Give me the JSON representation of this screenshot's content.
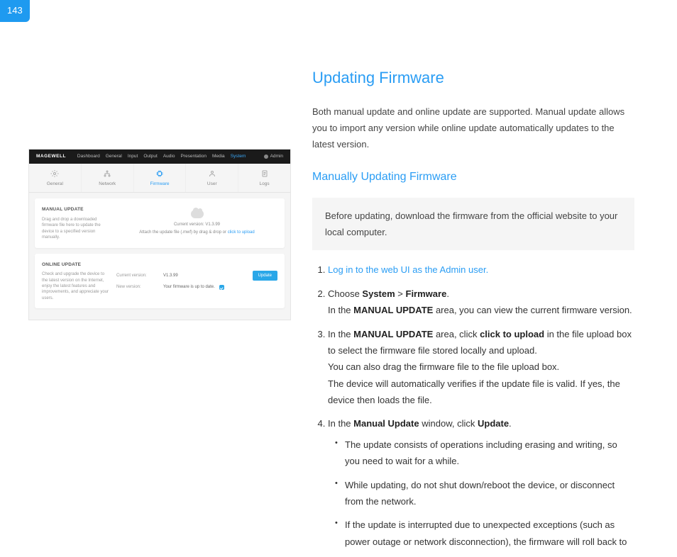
{
  "page_number": "143",
  "title": "Updating Firmware",
  "intro": "Both manual update and online update are supported. Manual update allows you to import any version while online update automatically updates to the latest version.",
  "section_heading": "Manually Updating Firmware",
  "note": "Before updating, download the firmware from the official website to your local computer.",
  "steps": {
    "s1": "Log in to the web UI as the Admin user.",
    "s2_prefix": "Choose ",
    "s2_system": "System",
    "s2_sep": " > ",
    "s2_firmware": "Firmware",
    "s2_suffix": ".",
    "s2_line2a": "In the ",
    "s2_line2b": "MANUAL UPDATE",
    "s2_line2c": " area, you can view the current firmware version.",
    "s3_a": "In the ",
    "s3_b": "MANUAL UPDATE",
    "s3_c": " area, click ",
    "s3_d": "click to upload",
    "s3_e": " in the file upload box to select the firmware file stored locally and upload.",
    "s3_f": "You can also drag the firmware file to the file upload box.",
    "s3_g": "The device will automatically verifies if the update file is valid. If yes, the device then loads the file.",
    "s4_a": "In the ",
    "s4_b": "Manual Update",
    "s4_c": " window, click ",
    "s4_d": "Update",
    "s4_e": ".",
    "b1": "The update consists of operations including erasing and writing, so you need to wait for a while.",
    "b2": "While updating, do not shut down/reboot the device, or disconnect from the network.",
    "b3": "If the update is interrupted due to unexpected exceptions (such as power outage or network disconnection), the firmware will roll back to"
  },
  "screenshot": {
    "brand": "MAGEWELL",
    "nav": [
      "Dashboard",
      "General",
      "Input",
      "Output",
      "Audio",
      "Presentation",
      "Media",
      "System"
    ],
    "nav_active": "System",
    "admin": "Admin",
    "tabs": [
      "General",
      "Network",
      "Firmware",
      "User",
      "Logs"
    ],
    "tab_active": "Firmware",
    "manual": {
      "title": "MANUAL UPDATE",
      "desc": "Drag and drop a downloaded firmware file here to update the device to a specified version manually.",
      "current_label": "Current version: V1.3.99",
      "attach_a": "Attach the update file (.mwf) by drag & drop or ",
      "attach_link": "click to upload"
    },
    "online": {
      "title": "ONLINE UPDATE",
      "desc": "Check and upgrade the device to the latest version on the Internet, enjoy the latest features and improvements, and appreciate your users.",
      "curr_label": "Current version:",
      "curr_val": "V1.3.99",
      "new_label": "New version:",
      "new_val": "Your firmware is up to date.",
      "button": "Update"
    }
  }
}
